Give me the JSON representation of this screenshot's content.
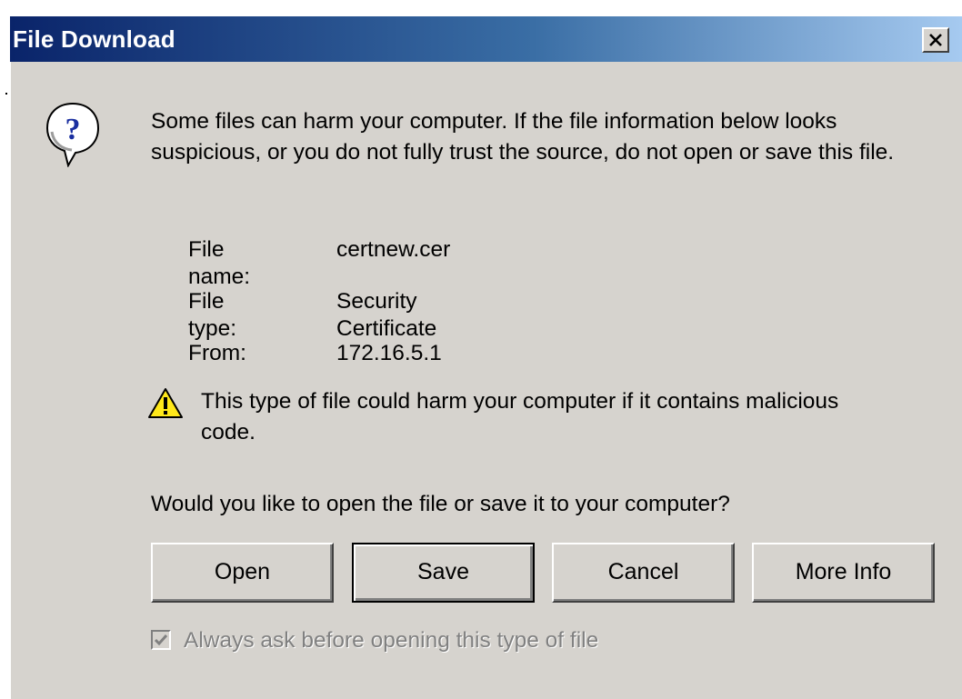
{
  "window": {
    "title": "File Download",
    "close_icon": "close-icon"
  },
  "message": {
    "icon": "question-icon",
    "text": "Some files can harm your computer. If the file information below looks suspicious, or you do not fully trust the source, do not open or save this file."
  },
  "file_info": {
    "name_label": "File name:",
    "name_value": "certnew.cer",
    "type_label": "File type:",
    "type_value": "Security Certificate",
    "from_label": "From:",
    "from_value": "172.16.5.1"
  },
  "warning": {
    "icon": "warning-icon",
    "text": "This type of file could harm your computer if it contains malicious code."
  },
  "prompt": "Would you like to open the file or save it to your computer?",
  "buttons": {
    "open": "Open",
    "save": "Save",
    "cancel": "Cancel",
    "more_info": "More Info"
  },
  "checkbox": {
    "label": "Always ask before opening this type of file",
    "checked": true,
    "disabled": true
  },
  "colors": {
    "title_gradient_start": "#0a246a",
    "title_gradient_end": "#a6caf0",
    "dialog_face": "#d6d3ce",
    "disabled_text": "#808080"
  }
}
